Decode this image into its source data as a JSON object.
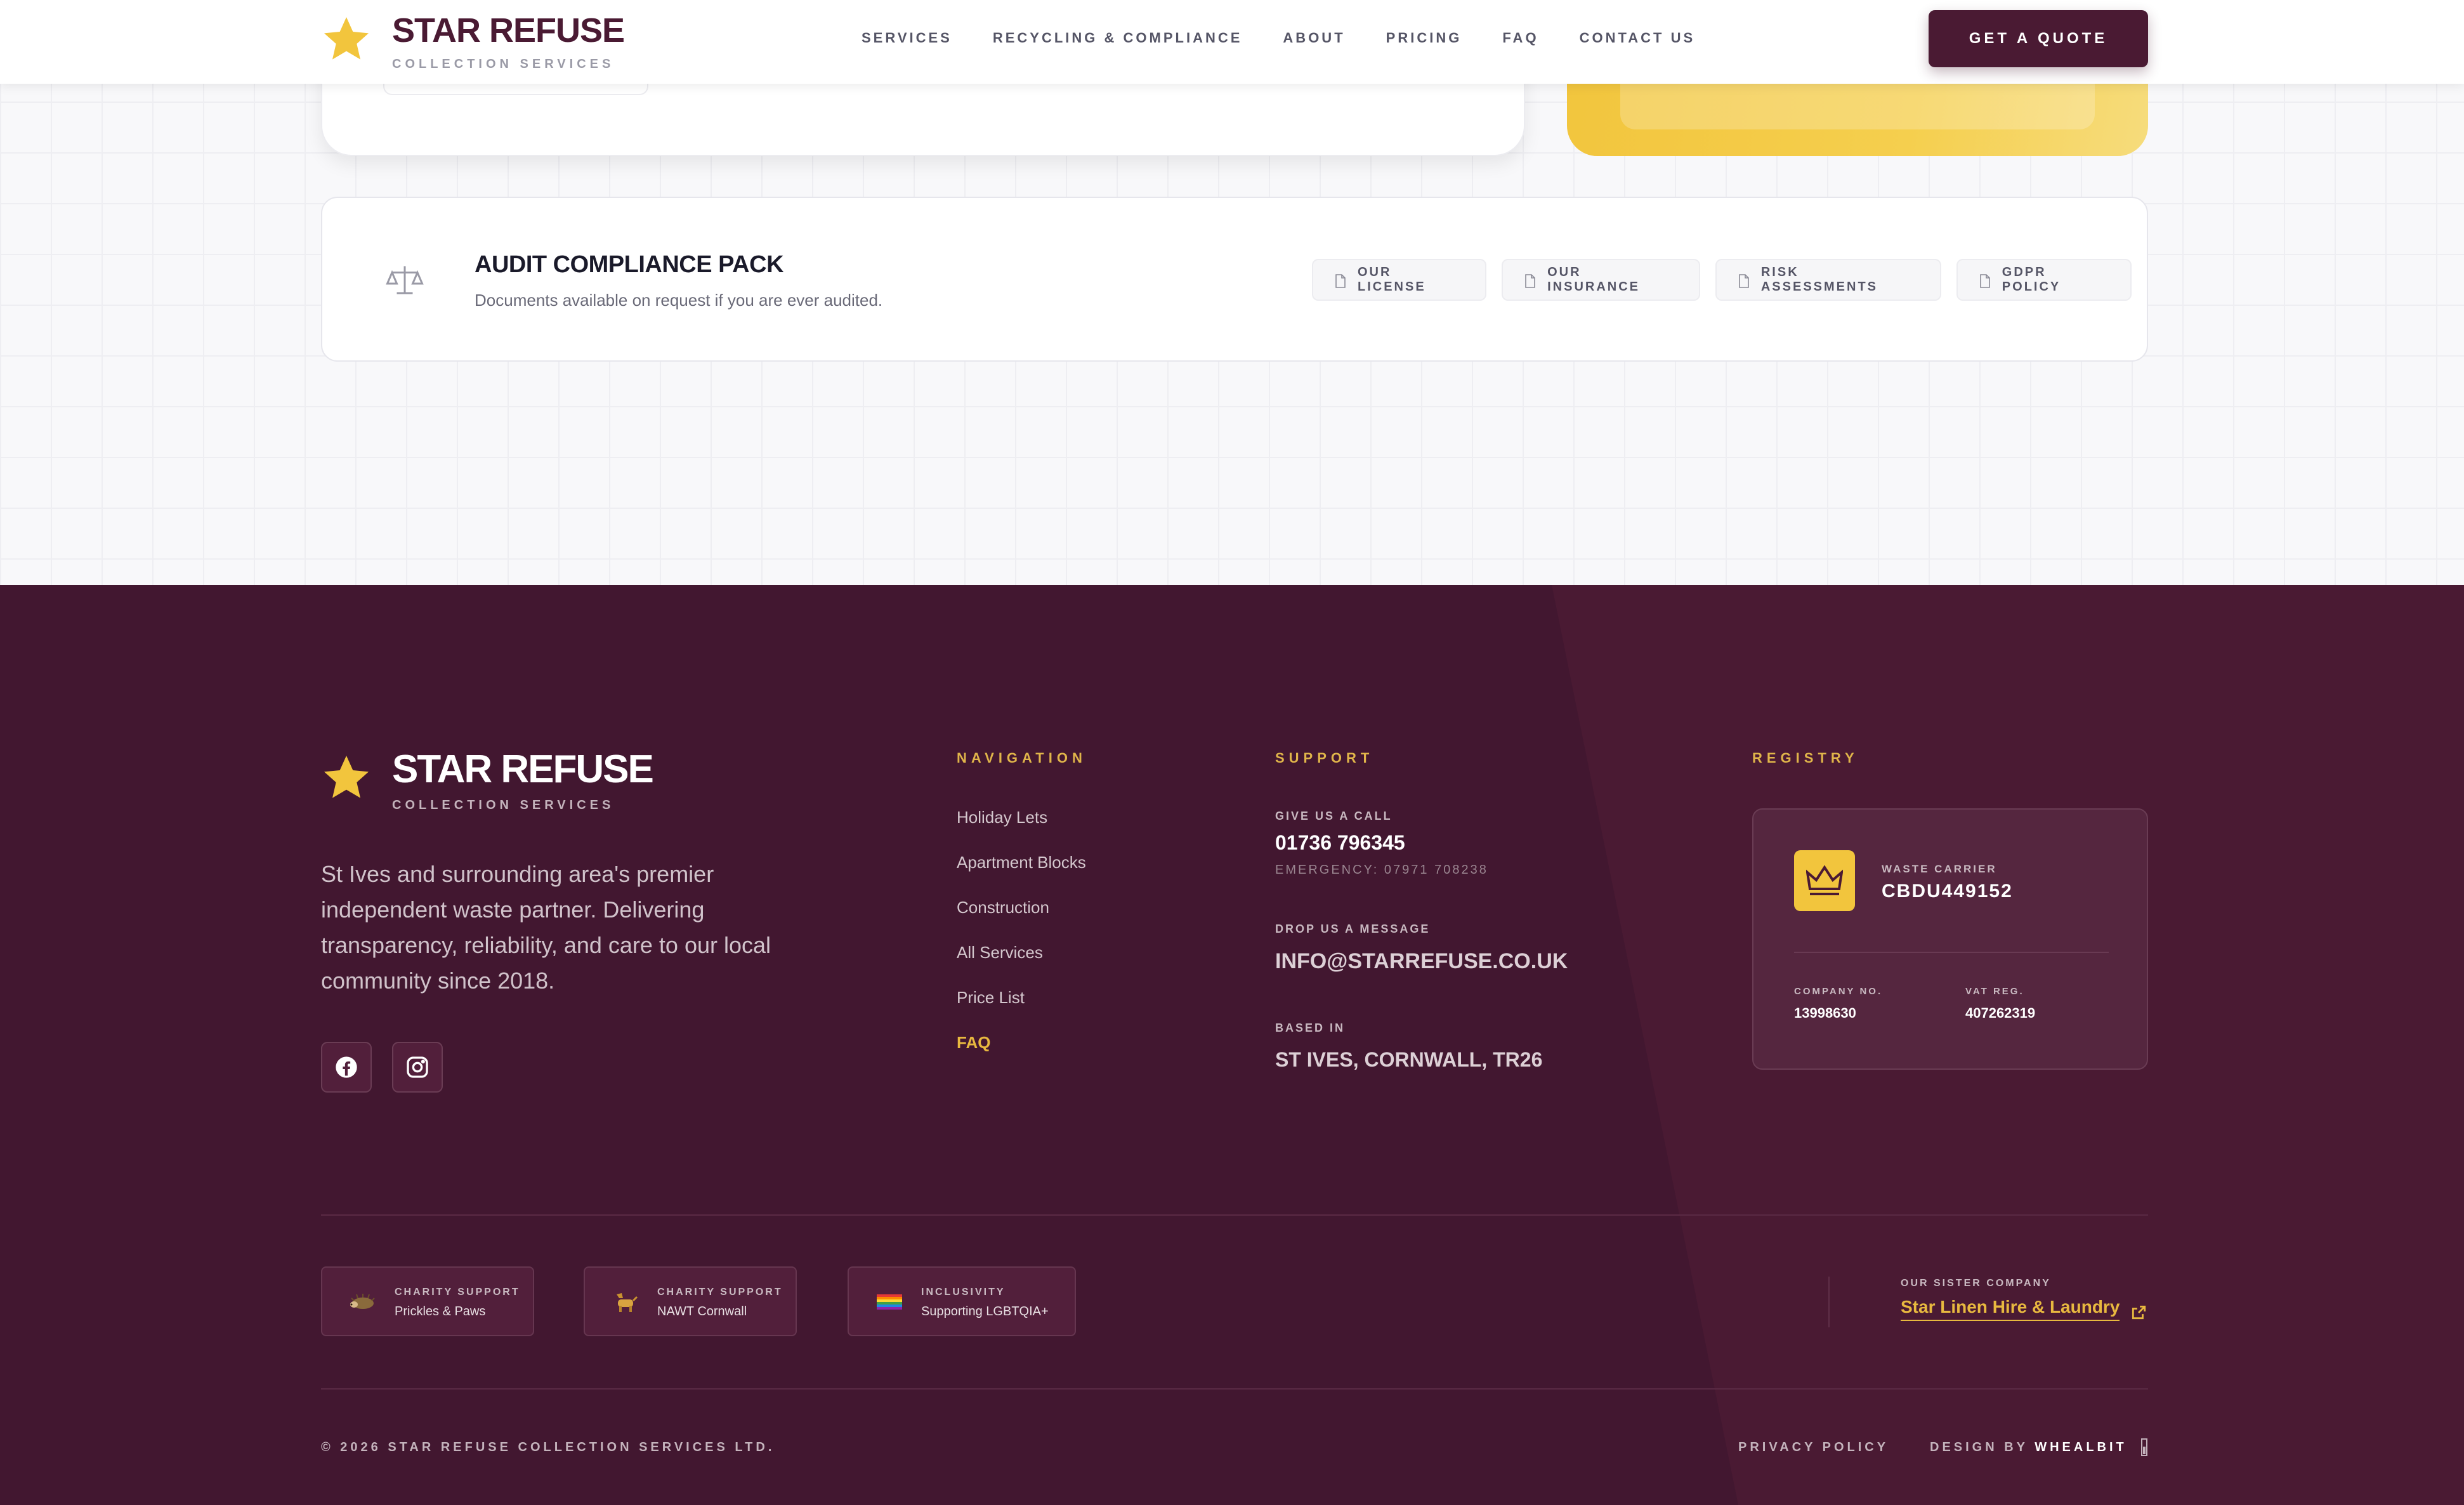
{
  "header": {
    "logo_title": "STAR REFUSE",
    "logo_sub": "COLLECTION SERVICES",
    "nav": [
      "SERVICES",
      "RECYCLING & COMPLIANCE",
      "ABOUT",
      "PRICING",
      "FAQ",
      "CONTACT US"
    ],
    "cta": "GET A QUOTE"
  },
  "audit": {
    "title": "AUDIT COMPLIANCE PACK",
    "description": "Documents available on request if you are ever audited.",
    "documents": [
      "OUR LICENSE",
      "OUR INSURANCE",
      "RISK ASSESSMENTS",
      "GDPR POLICY"
    ]
  },
  "footer": {
    "logo_title": "STAR REFUSE",
    "logo_sub": "COLLECTION SERVICES",
    "description": "St Ives and surrounding area's premier independent waste partner. Delivering transparency, reliability, and care to our local community since 2018.",
    "social": [
      "facebook-icon",
      "instagram-icon"
    ],
    "navigation": {
      "heading": "NAVIGATION",
      "links": [
        "Holiday Lets",
        "Apartment Blocks",
        "Construction",
        "All Services",
        "Price List",
        "FAQ"
      ],
      "active": "FAQ"
    },
    "support": {
      "heading": "SUPPORT",
      "call_label": "GIVE US A CALL",
      "phone": "01736 796345",
      "emergency": "EMERGENCY: 07971 708238",
      "message_label": "DROP US A MESSAGE",
      "email": "INFO@STARREFUSE.CO.UK",
      "based_label": "BASED IN",
      "location": "ST IVES, CORNWALL, TR26"
    },
    "registry": {
      "heading": "REGISTRY",
      "carrier_label": "WASTE CARRIER",
      "carrier_value": "CBDU449152",
      "company_label": "COMPANY NO.",
      "company_value": "13998630",
      "vat_label": "VAT REG.",
      "vat_value": "407262319"
    },
    "badges": [
      {
        "label": "CHARITY SUPPORT",
        "value": "Prickles & Paws",
        "icon": "hedgehog-icon"
      },
      {
        "label": "CHARITY SUPPORT",
        "value": "NAWT Cornwall",
        "icon": "dog-icon"
      },
      {
        "label": "INCLUSIVITY",
        "value": "Supporting LGBTQIA+",
        "icon": "pride-flag-icon"
      }
    ],
    "sister": {
      "label": "OUR SISTER COMPANY",
      "name": "Star Linen Hire & Laundry"
    },
    "copyright": "© 2026 STAR REFUSE COLLECTION SERVICES LTD.",
    "privacy": "PRIVACY POLICY",
    "design_prefix": "DESIGN BY",
    "design_brand": "WHEALBIT"
  },
  "colors": {
    "brand_plum": "#4a1a33",
    "accent_gold": "#f2c53d"
  }
}
